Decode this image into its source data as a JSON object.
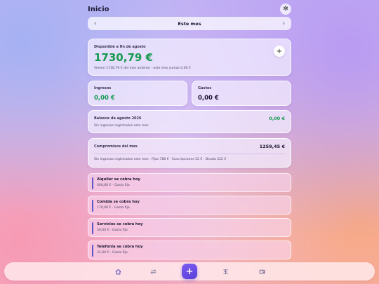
{
  "header": {
    "title": "Inicio"
  },
  "month_nav": {
    "label": "Este mes",
    "prev": "‹",
    "next": "›"
  },
  "available": {
    "label": "Disponible a fin de agosto",
    "amount": "1730,79 €",
    "note": "Vienen 1730,79 € del mes anterior · este mes sumas 0,00 €"
  },
  "income": {
    "label": "Ingresos",
    "amount": "0,00 €"
  },
  "expenses": {
    "label": "Gastos",
    "amount": "0,00 €"
  },
  "balance": {
    "label": "Balance de agosto 2026",
    "amount": "0,00 €",
    "note": "Sin ingresos registrados este mes"
  },
  "commitments": {
    "label": "Compromisos del mes",
    "amount": "1259,45 €",
    "note": "Sin ingresos registrados este mes · Fijos 786 € · Suscripciones 52 € · Deuda 422 €"
  },
  "bills": [
    {
      "title": "Alquiler se cobra hoy",
      "subtitle": "400,00 € · Gasto fijo"
    },
    {
      "title": "Comida se cobra hoy",
      "subtitle": "170,00 € · Gasto fijo"
    },
    {
      "title": "Servicios se cobra hoy",
      "subtitle": "50,00 € · Gasto fijo"
    },
    {
      "title": "Telefonía se cobra hoy",
      "subtitle": "31,00 € · Gasto fijo"
    }
  ],
  "tabbar": {
    "icons": [
      "home-icon",
      "transfer-icon",
      "add-icon",
      "budget-icon",
      "wallet-icon"
    ],
    "accent": "#5a3fd8",
    "positive": "#169a4f"
  }
}
